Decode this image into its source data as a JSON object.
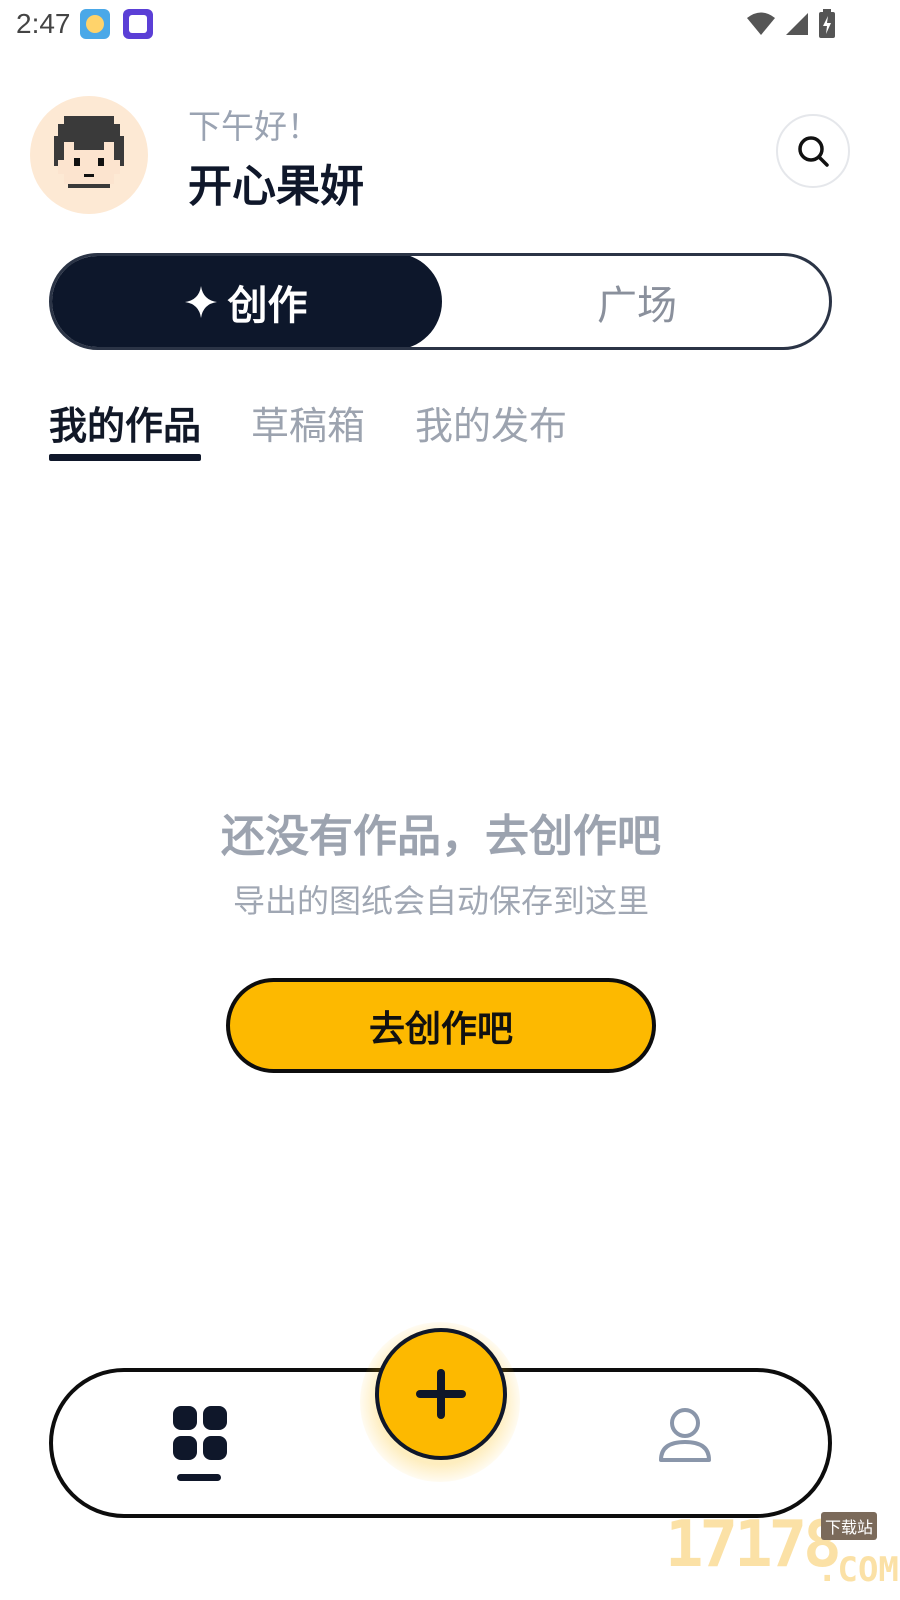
{
  "status_bar": {
    "time": "2:47"
  },
  "header": {
    "greeting": "下午好！",
    "username": "开心果妍"
  },
  "segment": {
    "active_label": "创作",
    "inactive_label": "广场"
  },
  "subtabs": [
    {
      "label": "我的作品",
      "active": true
    },
    {
      "label": "草稿箱",
      "active": false
    },
    {
      "label": "我的发布",
      "active": false
    }
  ],
  "empty_state": {
    "title": "还没有作品，去创作吧",
    "subtitle": "导出的图纸会自动保存到这里",
    "button_label": "去创作吧"
  },
  "watermark": {
    "number": "17178",
    "tag": "下载站",
    "suffix": ".COM"
  },
  "colors": {
    "accent": "#fdb900",
    "dark": "#0d172b",
    "muted": "#9ca3af"
  },
  "icons": {
    "search": "search-icon",
    "sparkle": "sparkle-icon",
    "home": "grid-icon",
    "add": "plus-icon",
    "profile": "user-icon"
  }
}
